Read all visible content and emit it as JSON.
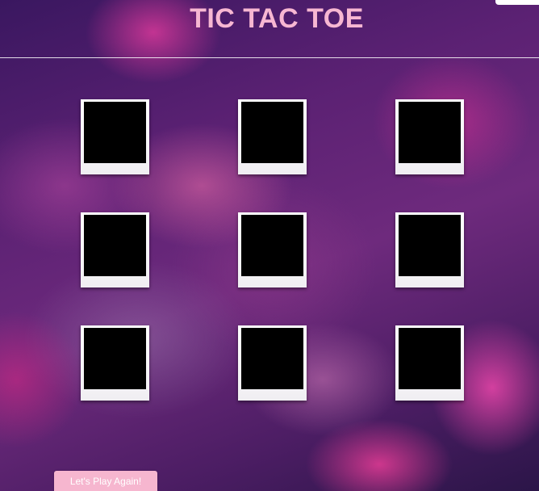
{
  "header": {
    "title": "TIC TAC TOE"
  },
  "board": {
    "rows": 3,
    "columns": 3,
    "cells": [
      "",
      "",
      "",
      "",
      "",
      "",
      "",
      "",
      ""
    ]
  },
  "controls": {
    "play_again_label": "Let's Play Again!"
  },
  "colors": {
    "title": "#f7b7d2",
    "cell_screen": "#000000",
    "cell_frame": "#ffffff",
    "button_background": "#f6b6cf"
  }
}
